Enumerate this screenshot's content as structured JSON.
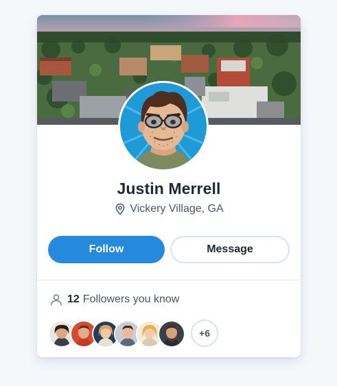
{
  "profile": {
    "name": "Justin Merrell",
    "location": "Vickery Village, GA",
    "cover_icon": "aerial-town-photo",
    "avatar_icon": "cartoon-avatar-glasses"
  },
  "actions": {
    "follow_label": "Follow",
    "message_label": "Message"
  },
  "followers": {
    "count": "12",
    "label": "Followers you know",
    "more_label": "+6",
    "avatars": [
      {
        "name": "follower-avatar-1",
        "skin": "#d9a888",
        "hair": "#2d1d14",
        "bg": "#e9e5df"
      },
      {
        "name": "follower-avatar-2",
        "skin": "#e0ae8c",
        "hair": "#5a3220",
        "bg": "#d94a2c"
      },
      {
        "name": "follower-avatar-3",
        "skin": "#f0c7a4",
        "hair": "#d9a85a",
        "bg": "#253c5a"
      },
      {
        "name": "follower-avatar-4",
        "skin": "#e7bb9a",
        "hair": "#3f2b1e",
        "bg": "#c9cdd2"
      },
      {
        "name": "follower-avatar-5",
        "skin": "#f2cba9",
        "hair": "#e0b24e",
        "bg": "#f2eadb"
      },
      {
        "name": "follower-avatar-6",
        "skin": "#d8a17d",
        "hair": "#4a2e1e",
        "bg": "#3b3f47"
      }
    ]
  },
  "colors": {
    "accent": "#2589dc",
    "text_primary": "#1f2733",
    "text_secondary": "#4a5568",
    "page_bg": "#f5f8fb"
  }
}
